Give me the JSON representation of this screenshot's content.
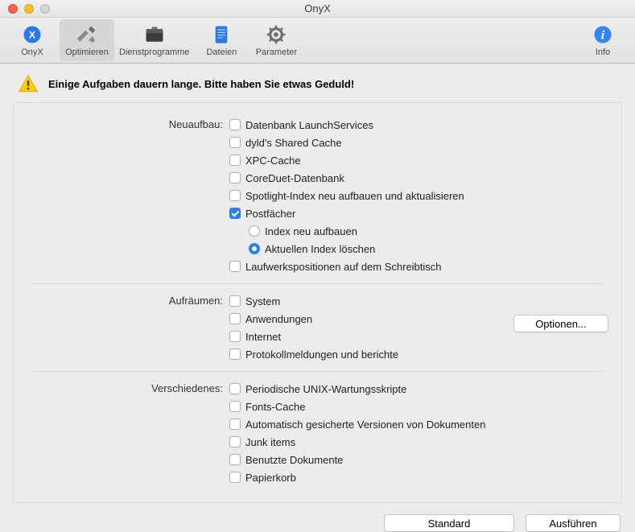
{
  "window_title": "OnyX",
  "toolbar": [
    {
      "id": "onyx",
      "label": "OnyX"
    },
    {
      "id": "optimieren",
      "label": "Optimieren",
      "selected": true
    },
    {
      "id": "dienstprogramme",
      "label": "Dienstprogramme"
    },
    {
      "id": "dateien",
      "label": "Dateien"
    },
    {
      "id": "parameter",
      "label": "Parameter"
    },
    {
      "id": "info",
      "label": "Info"
    }
  ],
  "alert": "Einige Aufgaben dauern lange. Bitte haben Sie etwas Geduld!",
  "sections": {
    "neuaufbau": {
      "label": "Neuaufbau:",
      "items": {
        "launchservices": {
          "label": "Datenbank LaunchServices",
          "checked": false
        },
        "dyld": {
          "label": "dyld's Shared Cache",
          "checked": false
        },
        "xpc": {
          "label": "XPC-Cache",
          "checked": false
        },
        "coreduet": {
          "label": "CoreDuet-Datenbank",
          "checked": false
        },
        "spotlight": {
          "label": "Spotlight-Index neu aufbauen und aktualisieren",
          "checked": false
        },
        "postfaecher": {
          "label": "Postfächer",
          "checked": true,
          "radio": {
            "rebuild": "Index neu aufbauen",
            "delete": "Aktuellen Index löschen",
            "selected": "delete"
          }
        },
        "laufwerkspos": {
          "label": "Laufwerkspositionen auf dem Schreibtisch",
          "checked": false
        }
      }
    },
    "aufraeumen": {
      "label": "Aufräumen:",
      "items": {
        "system": {
          "label": "System",
          "checked": false
        },
        "anwendungen": {
          "label": "Anwendungen",
          "checked": false
        },
        "internet": {
          "label": "Internet",
          "checked": false
        },
        "protokoll": {
          "label": "Protokollmeldungen und berichte",
          "checked": false
        }
      },
      "options_label": "Optionen..."
    },
    "verschiedenes": {
      "label": "Verschiedenes:",
      "items": {
        "unix": {
          "label": "Periodische UNIX-Wartungsskripte",
          "checked": false
        },
        "fonts": {
          "label": "Fonts-Cache",
          "checked": false
        },
        "autosave": {
          "label": "Automatisch gesicherte Versionen von Dokumenten",
          "checked": false
        },
        "junk": {
          "label": "Junk items",
          "checked": false
        },
        "recent": {
          "label": "Benutzte Dokumente",
          "checked": false
        },
        "trash": {
          "label": "Papierkorb",
          "checked": false
        }
      }
    }
  },
  "footer": {
    "standard": "Standard",
    "ausfuehren": "Ausführen"
  }
}
